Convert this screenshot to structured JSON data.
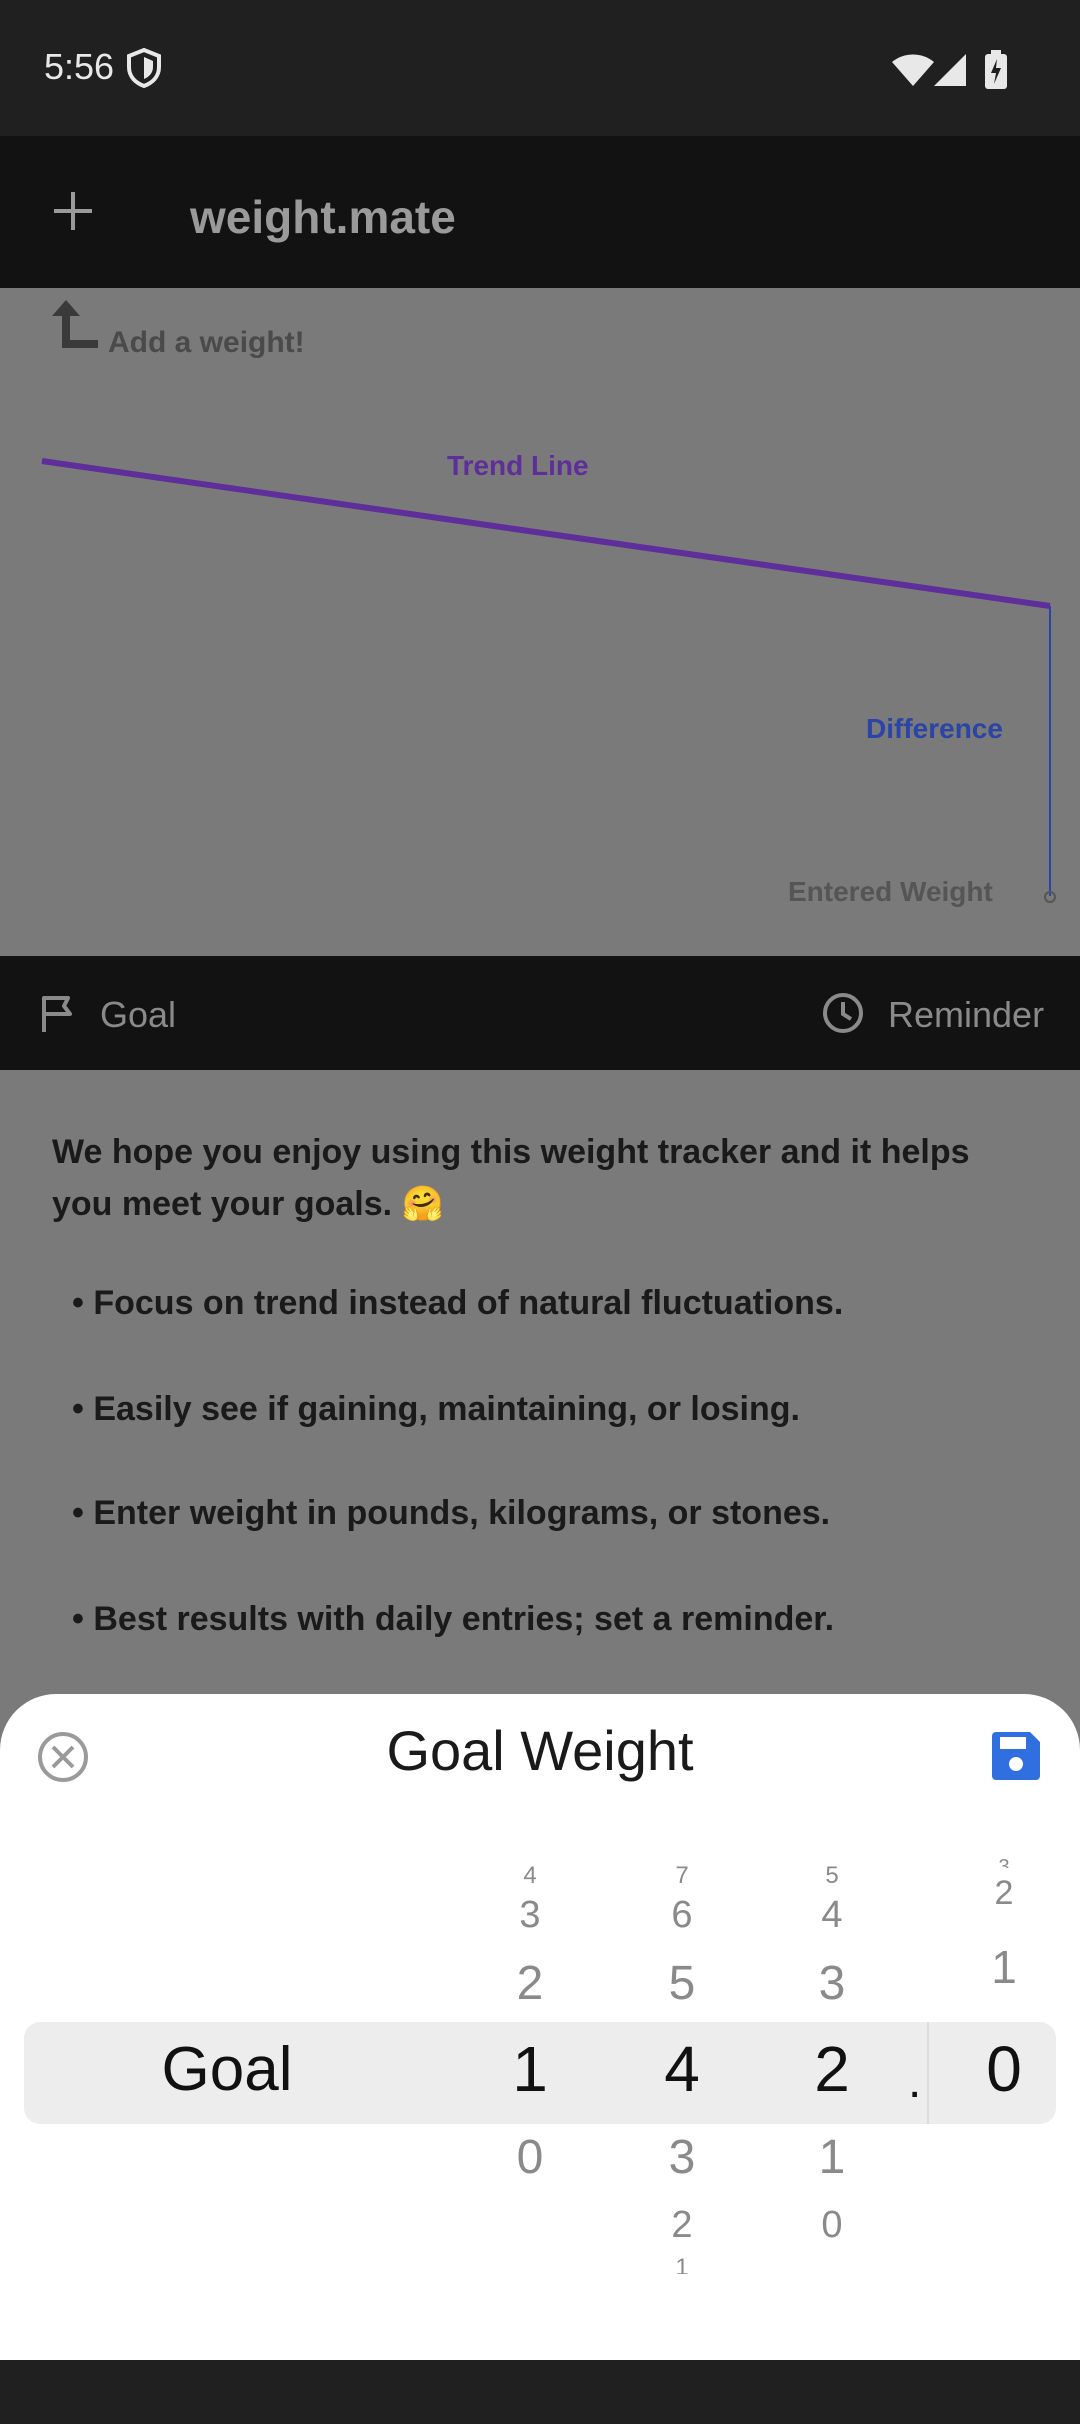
{
  "status_bar": {
    "time": "5:56"
  },
  "app_bar": {
    "title": "weight.mate"
  },
  "explainer": {
    "add_hint": "Add a weight!",
    "trend_label": "Trend Line",
    "difference_label": "Difference",
    "entered_label": "Entered Weight"
  },
  "tabs": {
    "goal": "Goal",
    "reminder": "Reminder"
  },
  "intro": {
    "text": "We hope you enjoy using this weight tracker and it helps you meet your goals. 🤗",
    "bullets": [
      "• Focus on trend instead of natural fluctuations.",
      "• Easily see if gaining, maintaining, or losing.",
      "• Enter weight in pounds, kilograms, or stones.",
      "• Best results with daily entries; set a reminder."
    ]
  },
  "sheet": {
    "title": "Goal Weight",
    "row_label": "Goal",
    "decimal_point": ".",
    "wheels": {
      "hundreds": {
        "above": [
          "4",
          "3",
          "2"
        ],
        "selected": "1",
        "below": [
          "0"
        ]
      },
      "tens": {
        "above": [
          "7",
          "6",
          "5"
        ],
        "selected": "4",
        "below": [
          "3",
          "2",
          "1"
        ]
      },
      "ones": {
        "above": [
          "5",
          "4",
          "3"
        ],
        "selected": "2",
        "below": [
          "1",
          "0"
        ]
      },
      "tenths": {
        "above": [
          "3",
          "2",
          "1"
        ],
        "selected": "0",
        "below": []
      }
    }
  },
  "colors": {
    "scrim": "#7a7a7a",
    "trend_line": "#5e2e9a",
    "difference_line": "#2a44a8",
    "save_icon": "#2f6fdf"
  }
}
